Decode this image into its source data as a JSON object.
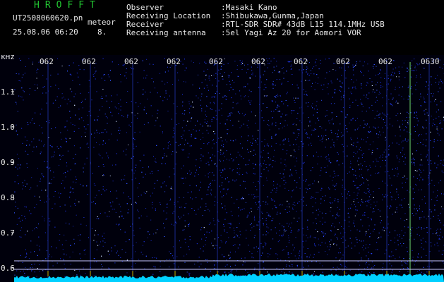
{
  "header": {
    "logo": "HROFFT",
    "filename": "UT2508060620.pn",
    "meteor_label": "meteor",
    "datetime": "25.08.06 06:20",
    "count": "8.",
    "fields": [
      {
        "label": "Observer",
        "value": ":Masaki Kano"
      },
      {
        "label": "Receiving Location",
        "value": ":Shibukawa,Gunma,Japan"
      },
      {
        "label": "Receiver",
        "value": ":RTL-SDR SDR# 43dB L15 114.1MHz USB"
      },
      {
        "label": "Receiving antenna",
        "value": ":5el Yagi Az 20 for Aomori VOR"
      }
    ]
  },
  "spectrogram": {
    "y_unit": "kHz",
    "y_ticks": [
      "1.1",
      "1.0",
      "0.9",
      "0.8",
      "0.7",
      "0.6"
    ],
    "x_ticks": [
      "062",
      "062",
      "062",
      "062",
      "062",
      "062",
      "062",
      "062",
      "062",
      "0630"
    ],
    "colors": {
      "background": "#000010",
      "noise": "#1a2cc8",
      "tick_line": "#c8b400",
      "trace": "#00c8ff",
      "ref_line": "#c8c8ff"
    }
  }
}
